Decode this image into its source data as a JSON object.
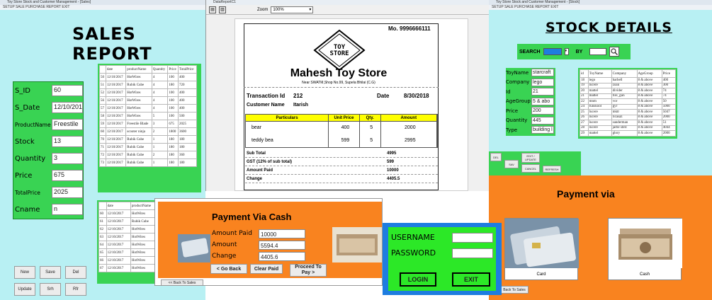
{
  "colors": {
    "cyan": "#b8f0f3",
    "green": "#39d353",
    "orange": "#f9831f",
    "brightgreen": "#2ce827",
    "blue": "#1e7de0",
    "yellow": "#ffff00"
  },
  "sales_window": {
    "title": "Toy Store Stock and Customer Management - [Sales]",
    "menu": "SETUP  SALE  PURCHASE  REPORT  EXIT",
    "heading": "SALES REPORT",
    "fields": [
      {
        "label": "S_ID",
        "value": "60"
      },
      {
        "label": "S_Date",
        "value": "12/10/2017"
      },
      {
        "label": "ProductName",
        "value": "Freestile"
      },
      {
        "label": "Stock",
        "value": "13"
      },
      {
        "label": "Quantity",
        "value": "3"
      },
      {
        "label": "Price",
        "value": "675"
      },
      {
        "label": "TotalPrice",
        "value": "2025"
      },
      {
        "label": "Cname",
        "value": "n"
      }
    ],
    "table": {
      "headers": [
        "",
        "date",
        "productName",
        "Quantity",
        "Price",
        "TotalPrice"
      ],
      "rows": [
        [
          "50",
          "12/10/2017",
          "HotWires",
          "4",
          "100",
          "400"
        ],
        [
          "51",
          "12/10/2017",
          "Rubik Cube",
          "4",
          "180",
          "720"
        ],
        [
          "52",
          "12/10/2017",
          "HotWires",
          "4",
          "100",
          "400"
        ],
        [
          "56",
          "12/10/2017",
          "HotWires",
          "4",
          "100",
          "400"
        ],
        [
          "57",
          "12/10/2017",
          "HotWires",
          "4",
          "100",
          "400"
        ],
        [
          "58",
          "12/10/2017",
          "HotWires",
          "5",
          "100",
          "500"
        ],
        [
          "59",
          "12/10/2017",
          "Freestile Blade",
          "3",
          "675",
          "2025"
        ],
        [
          "60",
          "12/10/2017",
          "scooter ninja",
          "2",
          "1800",
          "3600"
        ],
        [
          "70",
          "12/10/2017",
          "Rubik Cube",
          "1",
          "180",
          "180"
        ],
        [
          "71",
          "12/10/2017",
          "Rubik Cube",
          "1",
          "180",
          "180"
        ],
        [
          "72",
          "12/10/2017",
          "Rubik Cube",
          "2",
          "180",
          "360"
        ],
        [
          "73",
          "12/10/2017",
          "Rubik Cube",
          "1",
          "180",
          "180"
        ]
      ]
    },
    "buttons": [
      "New",
      "Save",
      "Del",
      "Update",
      "Srh",
      "Rfr"
    ]
  },
  "second_table": {
    "headers": [
      "",
      "date",
      "productName"
    ],
    "rows": [
      [
        "60",
        "12/10/2017",
        "HotWires"
      ],
      [
        "61",
        "12/10/2017",
        "Rubik Cube"
      ],
      [
        "62",
        "12/10/2017",
        "HotWires"
      ],
      [
        "63",
        "12/10/2017",
        "HotWires"
      ],
      [
        "64",
        "12/10/2017",
        "HotWires"
      ],
      [
        "65",
        "12/10/2017",
        "HotWires"
      ],
      [
        "66",
        "12/10/2017",
        "HotWires"
      ],
      [
        "67",
        "12/10/2017",
        "HotWires"
      ]
    ]
  },
  "report_viewer": {
    "title": "DataReportC1",
    "zoom_label": "Zoom",
    "zoom_value": "100%",
    "receipt": {
      "mobile": "Mo. 9996666111",
      "logo": "TOY STORE",
      "store_name": "Mahesh Toy Store",
      "address": "Near SWATM,Shop No.99, Supela Bhilai (C.G)",
      "transaction_label": "Transaction Id",
      "transaction_id": "212",
      "date_label": "Date",
      "date_value": "8/30/2018",
      "customer_label": "Customer Name",
      "customer_value": "Itarish",
      "columns": [
        "Particulars",
        "Unit Price",
        "Qty.",
        "Amount"
      ],
      "items": [
        {
          "name": "bear",
          "price": "400",
          "qty": "5",
          "amount": "2000"
        },
        {
          "name": "teddy bea",
          "price": "599",
          "qty": "5",
          "amount": "2995"
        }
      ],
      "totals": [
        {
          "label": "Sub Total",
          "value": "4995"
        },
        {
          "label": "GST (12% of sub total)",
          "value": "599"
        },
        {
          "label": "Amount Paid",
          "value": "10000"
        },
        {
          "label": "Change",
          "value": "4405.5"
        }
      ]
    }
  },
  "stock_window": {
    "title": "Toy Store Stock and Customer Management - [Stock]",
    "menu": "SETUP  SALE  PURCHASE  REPORT  EXIT",
    "heading": "STOCK DETAILS",
    "search_label": "SEARCH",
    "by_label": "BY",
    "fields": [
      {
        "label": "ToyName",
        "value": "starcraft"
      },
      {
        "label": "Company",
        "value": "lego"
      },
      {
        "label": "Id",
        "value": "21"
      },
      {
        "label": "AgeGroup",
        "value": "5 & abo"
      },
      {
        "label": "Price",
        "value": "200"
      },
      {
        "label": "Quantity",
        "value": "445"
      },
      {
        "label": "Type",
        "value": "building l"
      }
    ],
    "table": {
      "headers": [
        "id",
        "ToyName",
        "Company",
        "AgeGroup",
        "Price"
      ],
      "rows": [
        [
          "18",
          "lego",
          "barbell",
          "8 & above",
          "400"
        ],
        [
          "19",
          "lucere",
          "zoan",
          "8 & above",
          "300"
        ],
        [
          "20",
          "mattel",
          "divider",
          "8 & above",
          "74"
        ],
        [
          "21",
          "mattel",
          "fire_gun",
          "8 & above",
          "74"
        ],
        [
          "22",
          "mnm",
          "vor",
          "8 & above",
          "50"
        ],
        [
          "24",
          "funskool",
          "gyr",
          "8 & above",
          "5000"
        ],
        [
          "25",
          "lucere",
          "mktr",
          "8 & above",
          "5047"
        ],
        [
          "26",
          "lucere",
          "ricasaz",
          "8 & above",
          "2000"
        ],
        [
          "27",
          "lucere",
          "sanderman",
          "8 & above",
          "51"
        ],
        [
          "28",
          "lucere",
          "jarbe sbrd",
          "8 & above",
          "4044"
        ],
        [
          "29",
          "mattel",
          "glory",
          "8 & above",
          "2000"
        ]
      ]
    },
    "buttons": [
      "EDIT / UPDATE",
      "CANCEL",
      "SAV",
      "DEL",
      "REFRESH"
    ]
  },
  "payment_via": {
    "heading": "Payment via",
    "card_label": "Card",
    "cash_label": "Cash",
    "back_label": "Back To Sales"
  },
  "payment_cash": {
    "heading": "Payment Via Cash",
    "fields": [
      {
        "label": "Amount Paid",
        "value": "10000"
      },
      {
        "label": "Amount",
        "value": "5594.4"
      },
      {
        "label": "Change",
        "value": "4405.6"
      }
    ],
    "buttons": [
      "< Go Back",
      "Clear Paid",
      "Proceed To Pay >"
    ],
    "back_label": "<< Back To Sales"
  },
  "login": {
    "username_label": "USERNAME",
    "password_label": "PASSWORD",
    "username_value": "",
    "password_value": "",
    "login_label": "LOGIN",
    "exit_label": "EXIT"
  }
}
